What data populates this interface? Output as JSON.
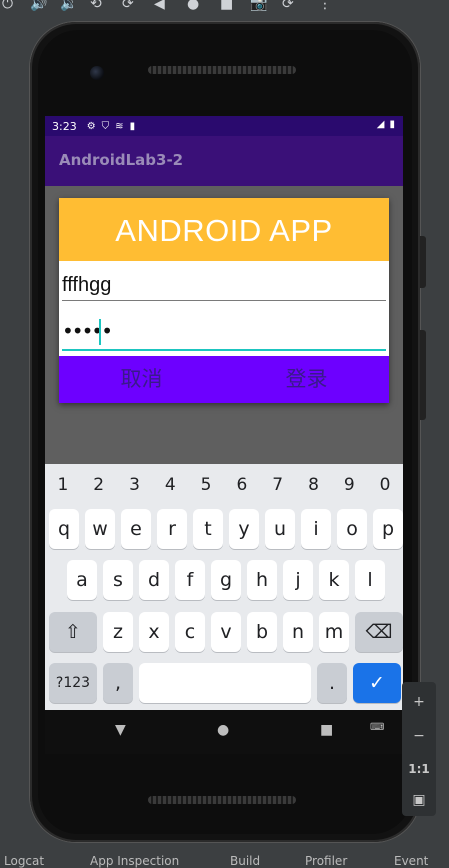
{
  "toolbar": {
    "icons": [
      "reboot-icon",
      "volume-up-icon",
      "volume-down-icon",
      "rotate-left-icon",
      "rotate-right-icon",
      "back-icon",
      "home-icon",
      "overview-icon",
      "screenshot-icon",
      "snapshot-icon",
      "more-icon"
    ]
  },
  "status_bar": {
    "time": "3:23",
    "icons": [
      "settings-icon",
      "shield-icon",
      "wifi-off-icon",
      "sd-card-icon",
      "signal-icon",
      "battery-icon"
    ]
  },
  "app_bar": {
    "title": "AndroidLab3-2"
  },
  "dialog": {
    "header": "ANDROID APP",
    "username_value": "fffhgg",
    "password_value": "•••••",
    "cancel_label": "取消",
    "login_label": "登录"
  },
  "keyboard": {
    "numbers": [
      "1",
      "2",
      "3",
      "4",
      "5",
      "6",
      "7",
      "8",
      "9",
      "0"
    ],
    "row1": [
      "q",
      "w",
      "e",
      "r",
      "t",
      "y",
      "u",
      "i",
      "o",
      "p"
    ],
    "row2": [
      "a",
      "s",
      "d",
      "f",
      "g",
      "h",
      "j",
      "k",
      "l"
    ],
    "row3": [
      "z",
      "x",
      "c",
      "v",
      "b",
      "n",
      "m"
    ],
    "sym_label": "?123",
    "comma_label": ",",
    "period_label": ".",
    "enter_icon": "check-icon",
    "shift_icon": "shift-icon",
    "backspace_icon": "backspace-icon"
  },
  "side_panel": {
    "zoom_in": "+",
    "zoom_out": "−",
    "one_to_one": "1:1"
  },
  "ide_bottom": {
    "items": [
      "Logcat",
      "App Inspection",
      "Build",
      "Profiler",
      "Event"
    ]
  },
  "colors": {
    "status_bar": "#2a0a6e",
    "app_bar": "#3a1078",
    "dialog_header": "#ffbd33",
    "button_bar": "#6d00ff",
    "focus_underline": "#1bc5c0",
    "enter_key": "#1a73e8"
  }
}
